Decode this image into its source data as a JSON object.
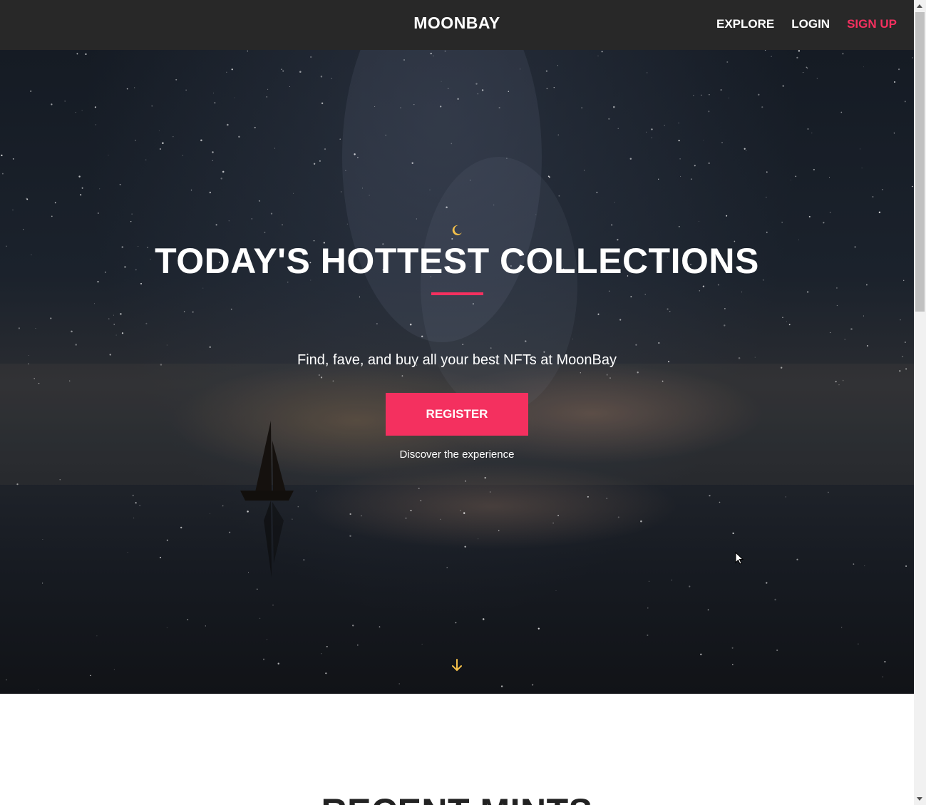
{
  "nav": {
    "brand": "MOONBAY",
    "links": [
      {
        "label": "EXPLORE"
      },
      {
        "label": "LOGIN"
      },
      {
        "label": "SIGN UP"
      }
    ],
    "accent_color": "#f4305f"
  },
  "hero": {
    "icon": "moon-icon",
    "title": "TODAY'S HOTTEST COLLECTIONS",
    "subtitle": "Find, fave, and buy all your best NFTs at MoonBay",
    "register_label": "REGISTER",
    "register_caption": "Discover the experience",
    "scroll_icon": "arrow-down-icon"
  },
  "recent": {
    "title": "RECENT MINTS"
  }
}
